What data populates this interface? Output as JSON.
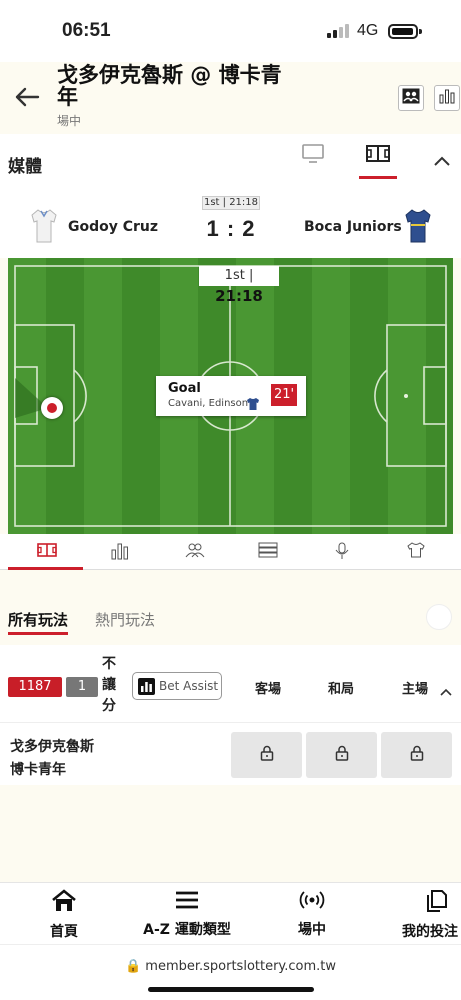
{
  "status": {
    "time": "06:51",
    "network": "4G"
  },
  "header": {
    "title": "戈多伊克魯斯 @ 博卡青年",
    "subtitle": "場中"
  },
  "media": {
    "label": "媒體"
  },
  "match": {
    "period_clock": "1st | 21:18",
    "home_team": "Godoy Cruz",
    "away_team": "Boca Juniors",
    "score": "1 : 2",
    "pitch_period": "1st |",
    "pitch_time": "21:18",
    "event": {
      "type": "Goal",
      "player": "Cavani, Edinson",
      "minute": "21'"
    }
  },
  "bet_tabs": {
    "all": "所有玩法",
    "popular": "熱門玩法"
  },
  "market": {
    "id": "1187",
    "count": "1",
    "name_chars": [
      "不",
      "讓",
      "分"
    ],
    "bet_assist": "Bet Assist",
    "columns": [
      "客場",
      "和局",
      "主場"
    ],
    "rows": [
      "戈多伊克魯斯",
      "博卡青年"
    ]
  },
  "nav": {
    "home": "首頁",
    "sports": "A-Z 運動類型",
    "live": "場中",
    "bets": "我的投注"
  },
  "url": "member.sportslottery.com.tw",
  "colors": {
    "accent": "#cc1f2b",
    "pitch": "#3f8a2a"
  }
}
